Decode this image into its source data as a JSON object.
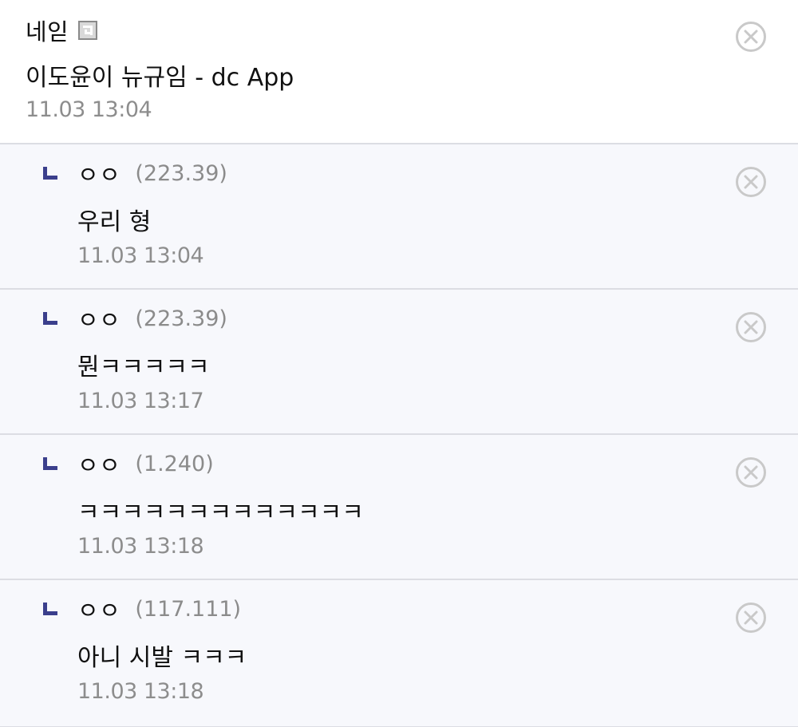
{
  "comments": [
    {
      "nick": "네읻",
      "has_gallog_icon": true,
      "ip": "",
      "text": "이도윤이 뉴규임 - dc App",
      "time": "11.03 13:04",
      "reply": false
    },
    {
      "nick": "ㅇㅇ",
      "ip": "(223.39)",
      "text": "우리 형",
      "time": "11.03 13:04",
      "reply": true
    },
    {
      "nick": "ㅇㅇ",
      "ip": "(223.39)",
      "text": "뭔ㅋㅋㅋㅋㅋ",
      "time": "11.03 13:17",
      "reply": true
    },
    {
      "nick": "ㅇㅇ",
      "ip": "(1.240)",
      "text": "ㅋㅋㅋㅋㅋㅋㅋㅋㅋㅋㅋㅋㅋ",
      "time": "11.03 13:18",
      "reply": true
    },
    {
      "nick": "ㅇㅇ",
      "ip": "(117.111)",
      "text": "아니 시발 ㅋㅋㅋ",
      "time": "11.03 13:18",
      "reply": true
    }
  ],
  "icons": {
    "delete": "close-circle-icon",
    "reply": "reply-arrow-icon",
    "gallog": "gallog-icon"
  },
  "colors": {
    "reply_background": "#f7f8fc",
    "reply_marker": "#3b3f8c",
    "divider": "#dcdde3",
    "meta_text": "#8d8d8d"
  }
}
